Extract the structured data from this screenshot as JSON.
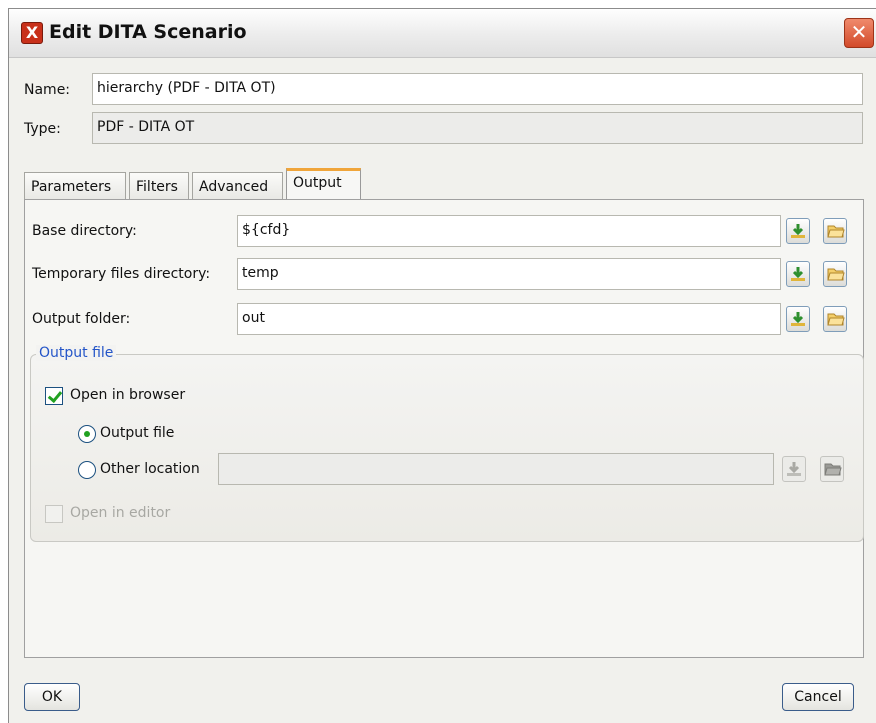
{
  "window": {
    "title": "Edit DITA Scenario"
  },
  "form": {
    "name_label": "Name:",
    "name_value": "hierarchy (PDF - DITA OT)",
    "type_label": "Type:",
    "type_value": "PDF - DITA OT"
  },
  "tabs": [
    {
      "label": "Parameters"
    },
    {
      "label": "Filters"
    },
    {
      "label": "Advanced"
    },
    {
      "label": "Output",
      "active": true
    }
  ],
  "output": {
    "base_dir_label": "Base directory:",
    "base_dir_value": "${cfd}",
    "temp_dir_label": "Temporary files directory:",
    "temp_dir_value": "temp",
    "out_folder_label": "Output folder:",
    "out_folder_value": "out",
    "group_title": "Output file",
    "open_in_browser_label": "Open in browser",
    "open_in_browser_checked": true,
    "radio_output_file_label": "Output file",
    "radio_other_location_label": "Other location",
    "other_location_value": "",
    "open_in_editor_label": "Open in editor",
    "open_in_editor_checked": false
  },
  "buttons": {
    "ok": "OK",
    "cancel": "Cancel"
  },
  "colors": {
    "group_title": "#2455c8",
    "accent_tab": "#f0a53a",
    "check_green": "#21a121"
  },
  "icons": [
    "app-icon",
    "close-icon",
    "insert-editor-variables-icon",
    "browse-folder-icon"
  ]
}
